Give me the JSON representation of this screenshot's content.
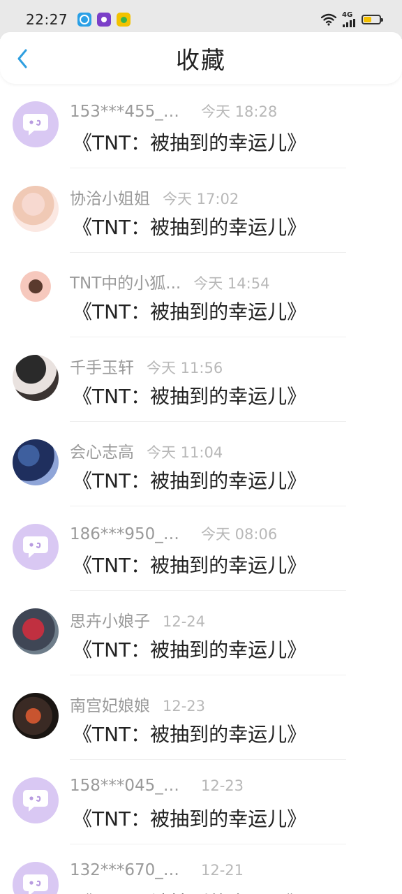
{
  "status_bar": {
    "time": "22:27",
    "network": "4G",
    "battery_level": 0.5,
    "icons": [
      "app-1-icon",
      "app-2-icon",
      "app-3-icon",
      "wifi-icon",
      "signal-icon",
      "battery-icon"
    ]
  },
  "header": {
    "title": "收藏",
    "back_icon": "chevron-left-icon"
  },
  "colors": {
    "accent": "#2f9fe0",
    "default_avatar_bg": "#d9c8f3",
    "status_bar_bg": "#e9e9e9",
    "username_text": "#9a9a9a",
    "time_text": "#b8b8b8"
  },
  "favorites": [
    {
      "user": "153***455_5...",
      "time": "今天 18:28",
      "title": "《TNT：被抽到的幸运儿》",
      "avatar": "default"
    },
    {
      "user": "协洽小姐姐",
      "time": "今天 17:02",
      "title": "《TNT：被抽到的幸运儿》",
      "avatar": "photo"
    },
    {
      "user": "TNT中的小狐...",
      "time": "今天 14:54",
      "title": "《TNT：被抽到的幸运儿》",
      "avatar": "photo"
    },
    {
      "user": "千手玉轩",
      "time": "今天 11:56",
      "title": "《TNT：被抽到的幸运儿》",
      "avatar": "photo"
    },
    {
      "user": "会心志高",
      "time": "今天 11:04",
      "title": "《TNT：被抽到的幸运儿》",
      "avatar": "photo"
    },
    {
      "user": "186***950_4...",
      "time": "今天 08:06",
      "title": "《TNT：被抽到的幸运儿》",
      "avatar": "default"
    },
    {
      "user": "思卉小娘子",
      "time": "12-24",
      "title": "《TNT：被抽到的幸运儿》",
      "avatar": "photo"
    },
    {
      "user": "南宫妃娘娘",
      "time": "12-23",
      "title": "《TNT：被抽到的幸运儿》",
      "avatar": "photo"
    },
    {
      "user": "158***045_6...",
      "time": "12-23",
      "title": "《TNT：被抽到的幸运儿》",
      "avatar": "default"
    },
    {
      "user": "132***670_4...",
      "time": "12-21",
      "title": "《TNT：被抽到的幸运儿》",
      "avatar": "default"
    }
  ]
}
